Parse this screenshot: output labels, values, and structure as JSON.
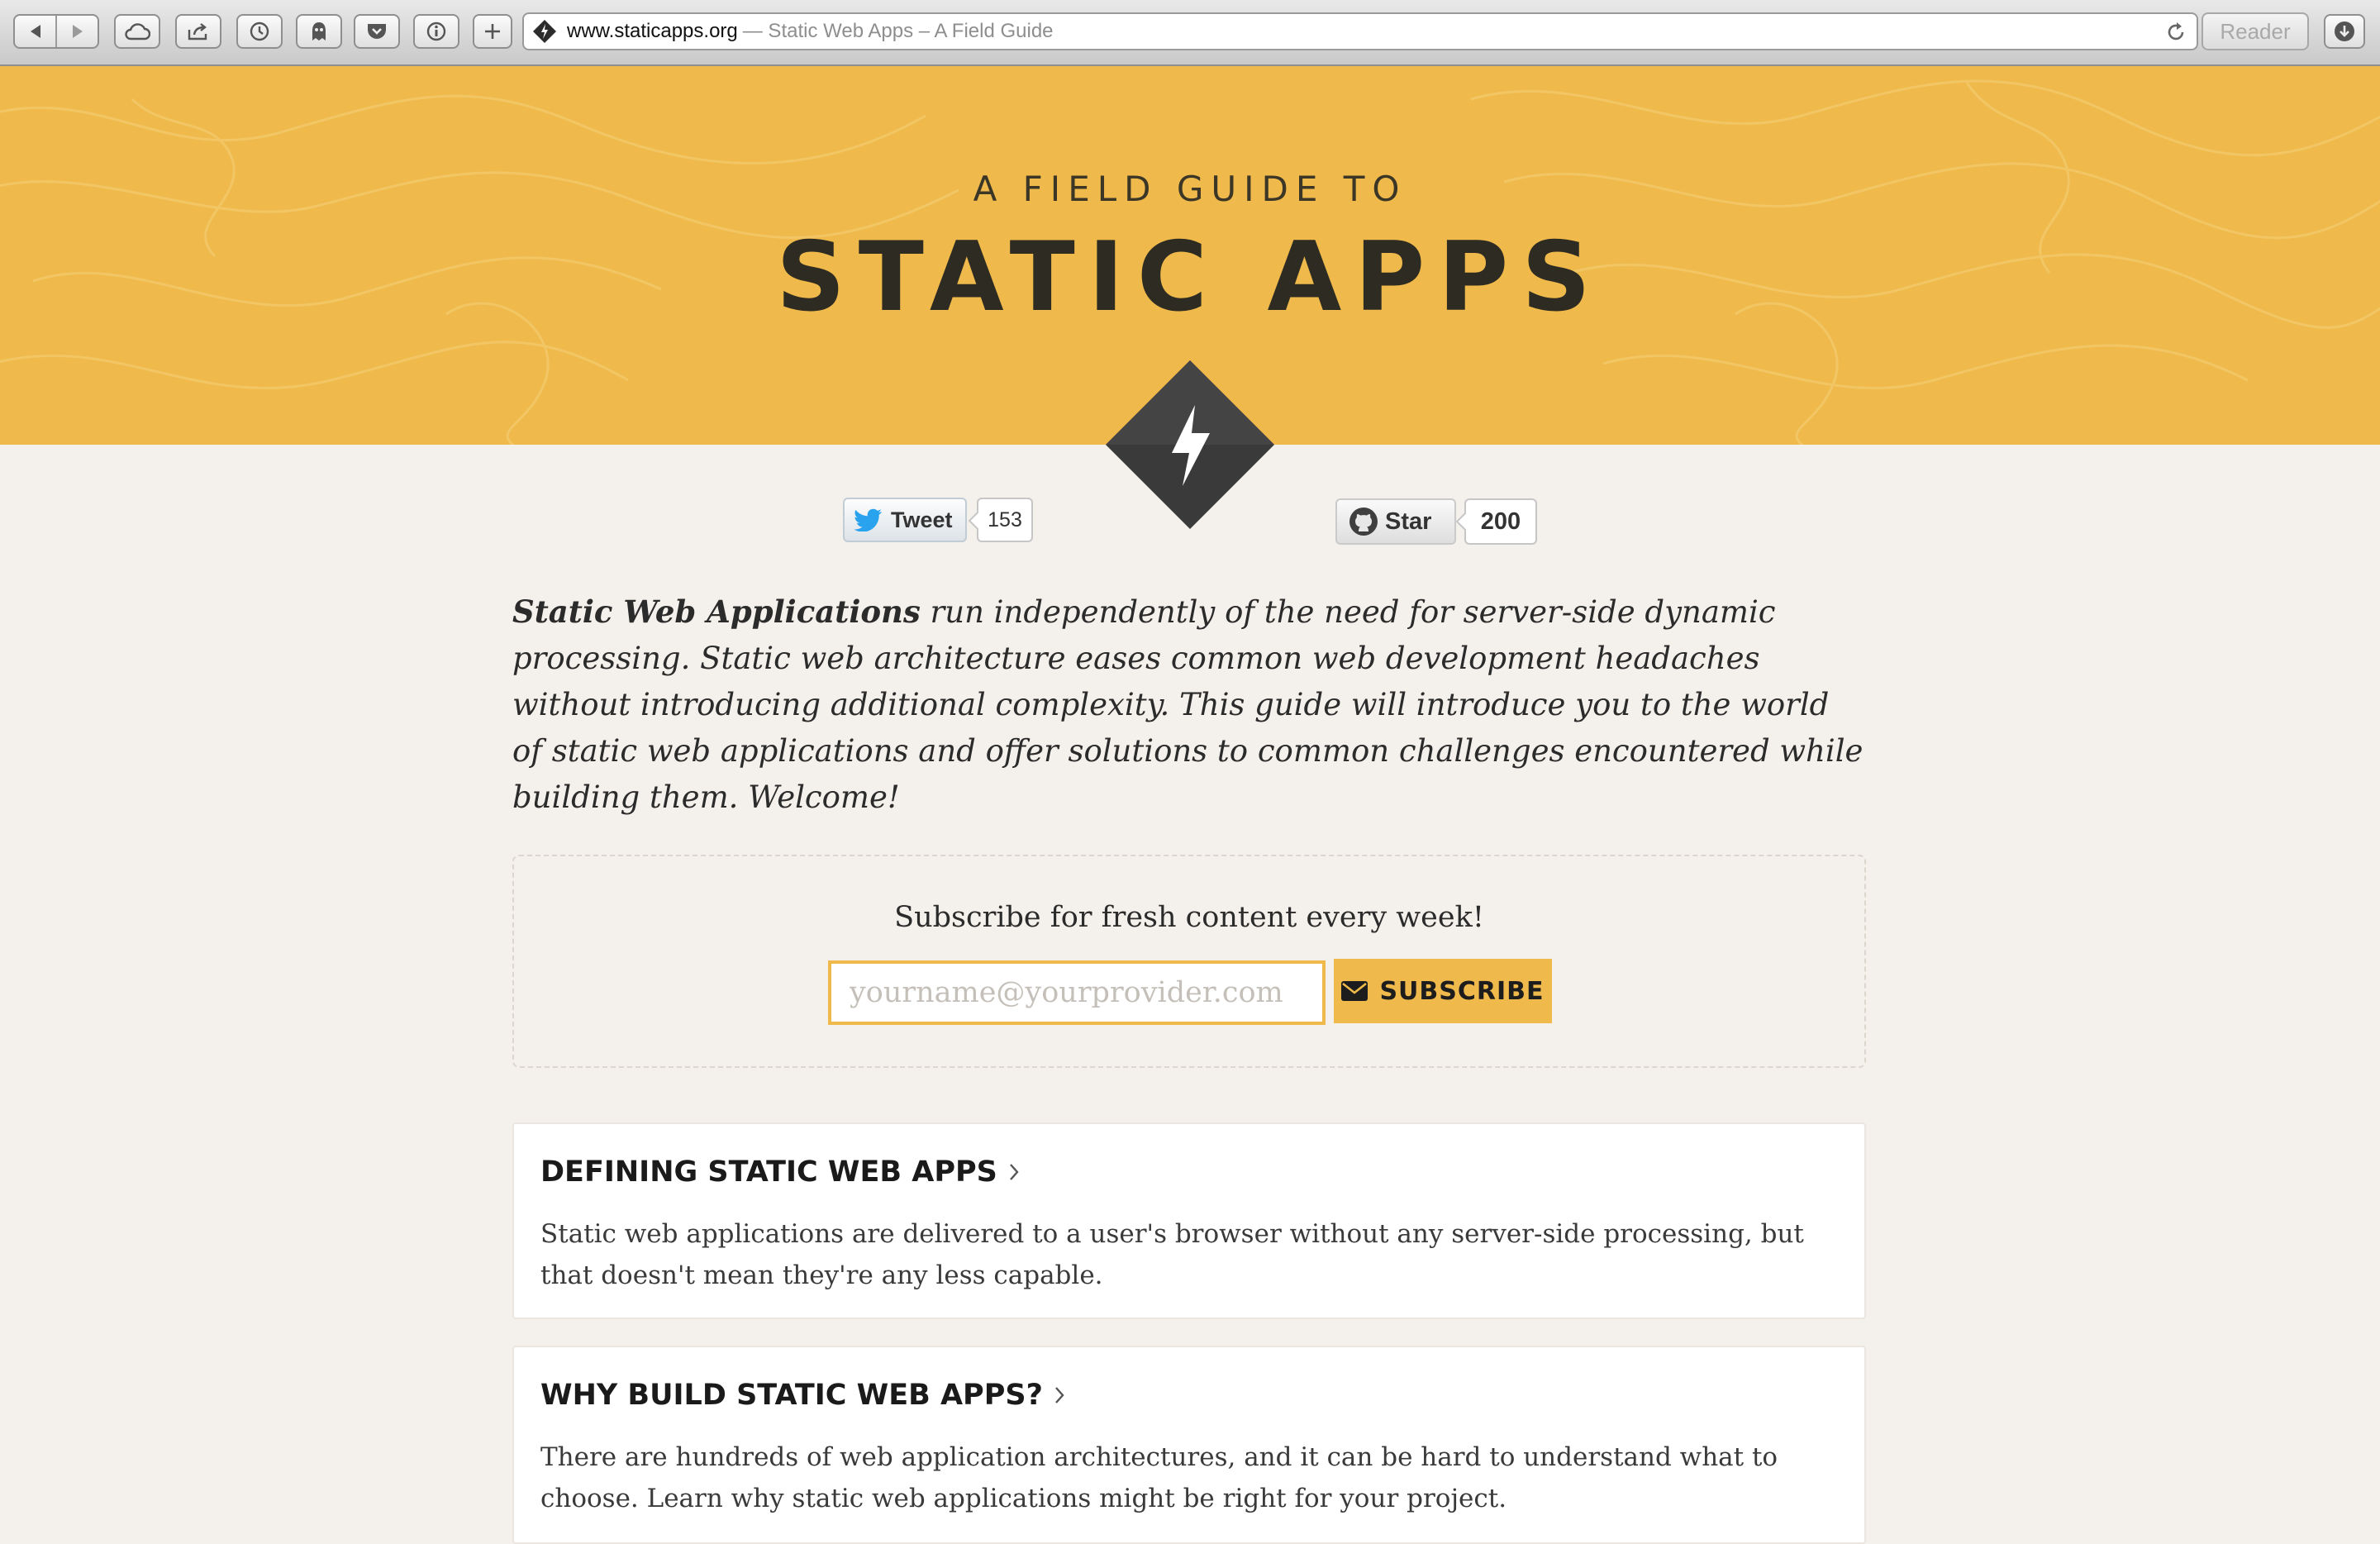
{
  "browser": {
    "domain": "www.staticapps.org",
    "page_title": "— Static Web Apps – A Field Guide",
    "reader_label": "Reader",
    "icons": [
      "back-icon",
      "forward-icon",
      "cloud-icon",
      "share-icon",
      "history-icon",
      "shield-icon",
      "pocket-icon",
      "info-icon",
      "new-tab-icon",
      "reload-icon",
      "download-icon"
    ]
  },
  "hero": {
    "kicker": "A FIELD GUIDE TO",
    "title": "STATIC APPS"
  },
  "social": {
    "tweet_label": "Tweet",
    "tweet_count": "153",
    "star_label": "Star",
    "star_count": "200"
  },
  "intro": {
    "lead": "Static Web Applications",
    "text": " run independently of the need for server-side dynamic processing. Static web architecture eases common web development headaches without introducing additional complexity. This guide will introduce you to the world of static web applications and offer solutions to common challenges encountered while building them. Welcome!"
  },
  "subscribe": {
    "heading": "Subscribe for fresh content every week!",
    "placeholder": "yourname@yourprovider.com",
    "button_label": "SUBSCRIBE"
  },
  "articles": [
    {
      "title": "DEFINING STATIC WEB APPS",
      "body": "Static web applications are delivered to a user's browser without any server-side processing, but that doesn't mean they're any less capable."
    },
    {
      "title": "WHY BUILD STATIC WEB APPS?",
      "body": "There are hundreds of web application architectures, and it can be hard to understand what to choose. Learn why static web applications might be right for your project."
    }
  ],
  "colors": {
    "accent": "#efba4b",
    "page_bg": "#f4f0eb",
    "dark": "#3a3a3a"
  }
}
